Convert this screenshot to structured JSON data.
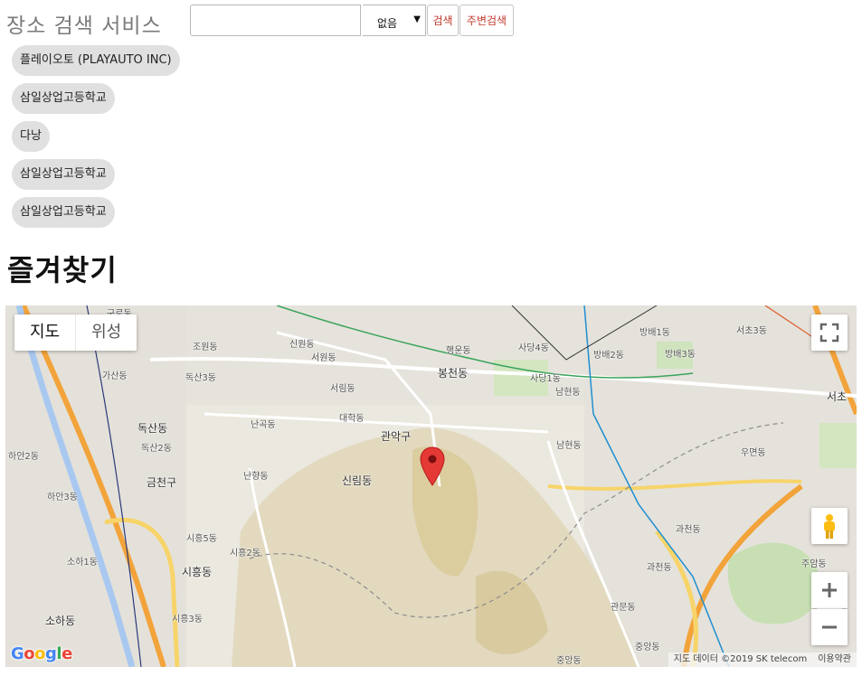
{
  "header": {
    "title": "장소 검색 서비스",
    "search_placeholder": "",
    "search_value": "",
    "category_selected": "없음",
    "search_button": "검색",
    "nearby_button": "주변검색"
  },
  "history": [
    "플레이오토 (PLAYAUTO INC)",
    "삼일상업고등학교",
    "다낭",
    "삼일상업고등학교",
    "삼일상업고등학교"
  ],
  "favorites_heading": "즐겨찾기",
  "map": {
    "type_buttons": [
      "지도",
      "위성"
    ],
    "attribution": "지도 데이터 ©2019 SK telecom",
    "terms": "이용약관",
    "logo": "Google",
    "labels": {
      "l1": "구로동",
      "l2": "조원동",
      "l3": "신원동",
      "l4": "서원동",
      "l5": "행운동",
      "l6": "사당4동",
      "l7": "방배1동",
      "l8": "서초3동",
      "l9": "가산동",
      "l10": "독산3동",
      "l11": "봉천동",
      "l12": "방배2동",
      "l13": "방배3동",
      "l14": "사당1동",
      "l15": "남현동",
      "l16": "서림동",
      "l17": "대학동",
      "l18": "서초",
      "l19": "난곡동",
      "l20": "독산동",
      "l21": "독산2동",
      "l22": "관악구",
      "l23": "남현동",
      "l24": "하안2동",
      "l25": "금천구",
      "l26": "난향동",
      "l27": "신림동",
      "l28": "우면동",
      "l29": "하안3동",
      "l30": "과천동",
      "l31": "시흥5동",
      "l32": "시흥2동",
      "l33": "소하1동",
      "l34": "시흥동",
      "l35": "과천동",
      "l36": "주암동",
      "l37": "시흥3동",
      "l38": "소하동",
      "l39": "관문동",
      "l40": "중앙동",
      "l41": "중앙동"
    },
    "icons": [
      "fullscreen-icon",
      "pegman-icon",
      "zoom-in-icon",
      "zoom-out-icon",
      "map-marker-icon"
    ]
  }
}
